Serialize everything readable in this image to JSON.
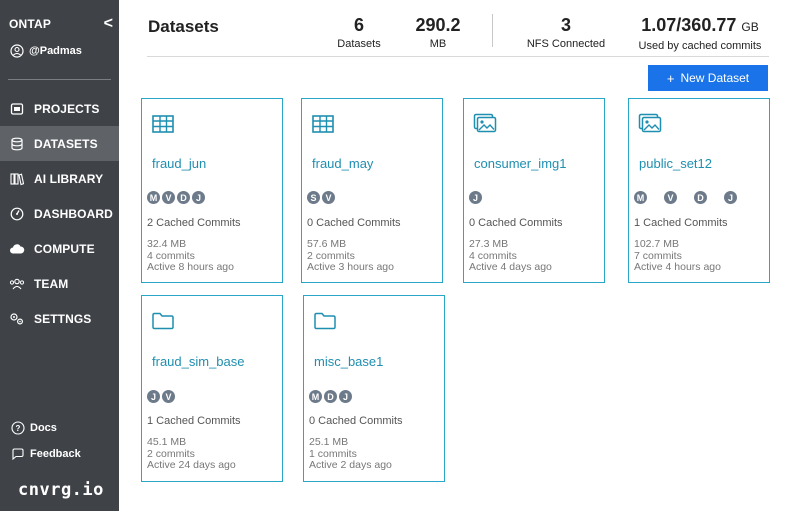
{
  "sidebar": {
    "brand": "ONTAP",
    "collapse": "<",
    "user": "@Padmas",
    "items": [
      {
        "label": "PROJECTS",
        "icon": "projects-icon"
      },
      {
        "label": "DATASETS",
        "icon": "datasets-icon",
        "active": true
      },
      {
        "label": "AI LIBRARY",
        "icon": "library-icon"
      },
      {
        "label": "DASHBOARD",
        "icon": "dashboard-icon"
      },
      {
        "label": "COMPUTE",
        "icon": "cloud-icon"
      },
      {
        "label": "TEAM",
        "icon": "team-icon"
      },
      {
        "label": "SETTNGS",
        "icon": "settings-icon"
      }
    ],
    "docs": "Docs",
    "feedback": "Feedback",
    "logo": "cnvrg.io"
  },
  "header": {
    "title": "Datasets",
    "stats": [
      {
        "value": "6",
        "label": "Datasets"
      },
      {
        "value": "290.2",
        "label": "MB"
      },
      {
        "value": "3",
        "label": "NFS Connected"
      },
      {
        "value": "1.07/360.77",
        "unit": "GB",
        "label": "Used by cached commits"
      }
    ],
    "new_button": "New Dataset",
    "new_button_icon": "+"
  },
  "datasets": [
    {
      "name": "fraud_jun",
      "icon": "table-icon",
      "avatars": [
        "M",
        "V",
        "D",
        "J"
      ],
      "cached": "2 Cached Commits",
      "size": "32.4 MB",
      "commits": "4 commits",
      "active": "Active 8 hours ago"
    },
    {
      "name": "fraud_may",
      "icon": "table-icon",
      "avatars": [
        "S",
        "V"
      ],
      "cached": "0 Cached Commits",
      "size": "57.6 MB",
      "commits": "2 commits",
      "active": "Active 3 hours ago"
    },
    {
      "name": "consumer_img1",
      "icon": "image-icon",
      "avatars": [
        "J"
      ],
      "cached": "0 Cached Commits",
      "size": "27.3 MB",
      "commits": "4 commits",
      "active": "Active 4 days ago"
    },
    {
      "name": "public_set12",
      "icon": "image-icon",
      "avatars": [
        "M",
        "V",
        "D",
        "J"
      ],
      "cached": "1 Cached Commits",
      "size": "102.7 MB",
      "commits": "7 commits",
      "active": "Active 4 hours ago"
    },
    {
      "name": "fraud_sim_base",
      "icon": "folder-icon",
      "avatars": [
        "J",
        "V"
      ],
      "cached": "1 Cached Commits",
      "size": "45.1 MB",
      "commits": "2 commits",
      "active": "Active 24 days ago"
    },
    {
      "name": "misc_base1",
      "icon": "folder-icon",
      "avatars": [
        "M",
        "D",
        "J"
      ],
      "cached": "0 Cached Commits",
      "size": "25.1 MB",
      "commits": "1 commits",
      "active": "Active 2 days ago"
    }
  ],
  "colors": {
    "sidebar": "#3f4348",
    "sidebar_active": "#5f6368",
    "accent": "#1a73e8",
    "card_border": "#2aa6c8",
    "link": "#1f8fb0",
    "avatar": "#6c7a8a"
  }
}
